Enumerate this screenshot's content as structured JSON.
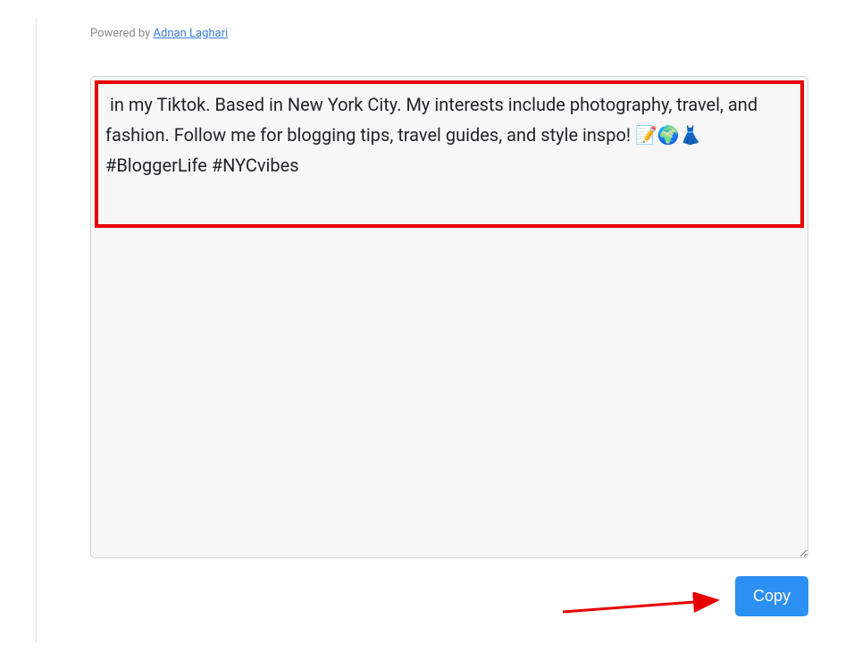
{
  "powered_by": {
    "prefix": "Powered by ",
    "link_text": "Adnan Laghari"
  },
  "output": {
    "text": " in my Tiktok. Based in New York City. My interests include photography, travel, and fashion. Follow me for blogging tips, travel guides, and style inspo! 📝🌍👗#BloggerLife #NYCvibes"
  },
  "buttons": {
    "copy_label": "Copy"
  }
}
